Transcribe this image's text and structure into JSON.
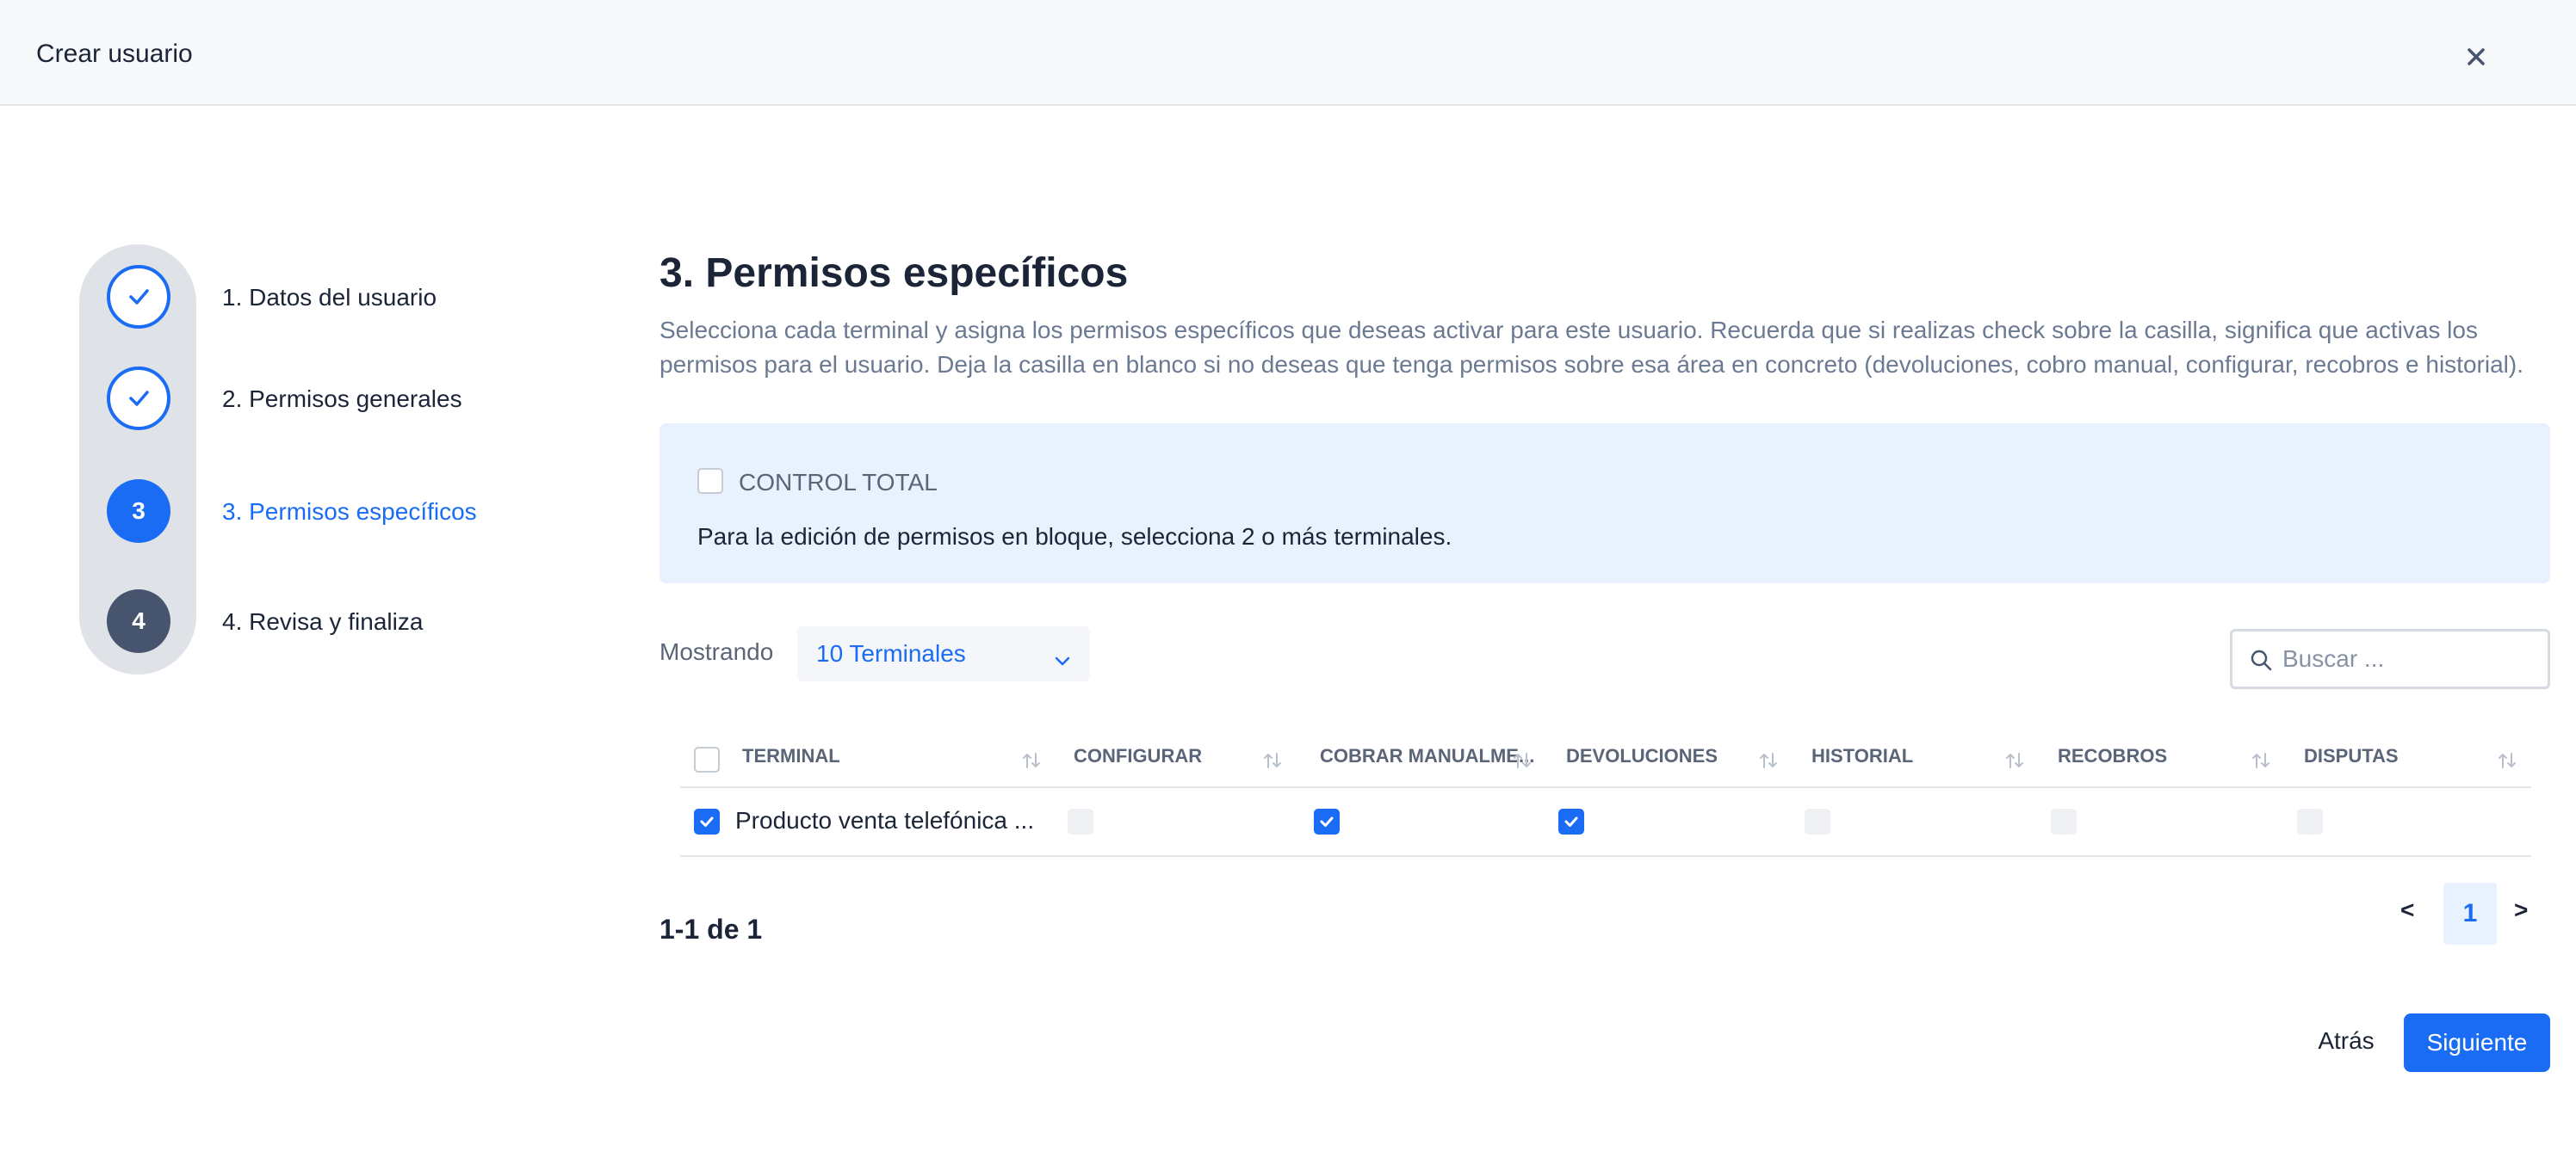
{
  "header": {
    "title": "Crear usuario",
    "close_icon": "close-icon"
  },
  "stepper": {
    "steps": [
      {
        "number": "1",
        "label": "1. Datos del usuario",
        "status": "done"
      },
      {
        "number": "2",
        "label": "2. Permisos generales",
        "status": "done"
      },
      {
        "number": "3",
        "label": "3. Permisos específicos",
        "status": "active"
      },
      {
        "number": "4",
        "label": "4. Revisa y finaliza",
        "status": "pending"
      }
    ]
  },
  "main": {
    "title": "3. Permisos específicos",
    "description": "Selecciona cada terminal y asigna los permisos específicos que deseas activar para este usuario. Recuerda que si realizas check sobre la casilla, significa que activas los permisos para el usuario. Deja la casilla en blanco si no deseas que tenga permisos sobre esa área en concreto (devoluciones, cobro manual, configurar, recobros e historial)."
  },
  "control_total": {
    "label": "CONTROL TOTAL",
    "checked": false,
    "info": "Para la edición de permisos en bloque, selecciona 2 o más terminales."
  },
  "toolbar": {
    "showing_label": "Mostrando",
    "page_size": "10 Terminales",
    "search_placeholder": "Buscar ..."
  },
  "table": {
    "columns": [
      "TERMINAL",
      "CONFIGURAR",
      "COBRAR MANUALME...",
      "DEVOLUCIONES",
      "HISTORIAL",
      "RECOBROS",
      "DISPUTAS"
    ],
    "rows": [
      {
        "selected": true,
        "terminal": "Producto venta telefónica ...",
        "configurar": false,
        "cobrar_manualmente": true,
        "devoluciones": true,
        "historial": false,
        "recobros": false,
        "disputas": false
      }
    ]
  },
  "pagination": {
    "summary": "1-1 de 1",
    "prev": "<",
    "current": "1",
    "next": ">"
  },
  "footer": {
    "back_label": "Atrás",
    "next_label": "Siguiente"
  },
  "colors": {
    "primary": "#1a6cf5",
    "info_bg": "#e8f2fe",
    "step_pending": "#46546d",
    "text": "#1c2437",
    "muted": "#6b7a92"
  }
}
